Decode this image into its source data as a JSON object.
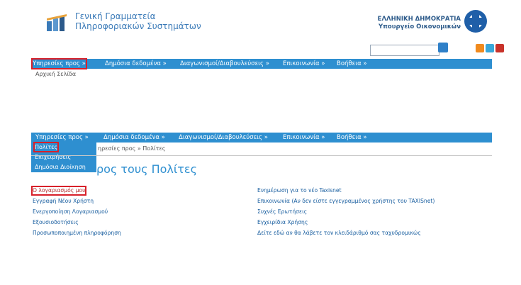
{
  "header": {
    "org_line1": "Γενική Γραμματεία",
    "org_line2": "Πληροφοριακών Συστημάτων",
    "gov_line1": "ΕΛΛΗΝΙΚΗ ΔΗΜΟΚΡΑΤΙΑ",
    "gov_line2": "Υπουργείο Οικονομικών"
  },
  "nav": [
    "Υπηρεσίες προς »",
    "Δημόσια δεδομένα »",
    "Διαγωνισμοί/Διαβουλεύσεις »",
    "Επικοινωνία »",
    "Βοήθεια »"
  ],
  "home_link": "Αρχική Σελίδα",
  "dropdown": [
    "Πολίτες",
    "Επιχειρήσεις",
    "Δημόσια Διοίκηση"
  ],
  "breadcrumb": "ηρεσίες προς  »  Πολίτες",
  "page_title": "ρος τους Πολίτες",
  "left_links": [
    "Ο λογαριασμός μου",
    "Εγγραφή Νέου Χρήστη",
    "Ενεργοποίηση Λογαριασμού",
    "Εξουσιοδοτήσεις",
    "Προσωποποιημένη πληροφόρηση"
  ],
  "right_links": [
    "Ενημέρωση για το νέο Taxisnet",
    "Επικοινωνία (Αν δεν είστε εγγεγραμμένος χρήστης του TAXISnet)",
    "Συχνές Ερωτήσεις",
    "Εγχειρίδια Χρήσης",
    "Δείτε εδώ αν θα λάβετε τον κλειδάριθμό σας ταχυδρομικώς"
  ],
  "colors": {
    "nav_bg": "#2e8fd0",
    "highlight": "#d8202a",
    "link": "#b22a2a"
  },
  "icons": [
    "logo-icon",
    "greek-seal-icon",
    "search-icon",
    "rss-icon",
    "twitter-icon",
    "youtube-icon"
  ]
}
